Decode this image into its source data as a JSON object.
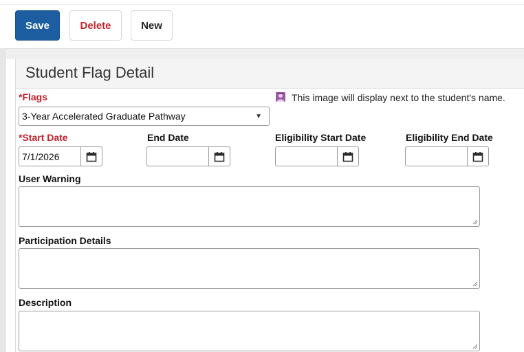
{
  "toolbar": {
    "save_label": "Save",
    "delete_label": "Delete",
    "new_label": "New"
  },
  "panel": {
    "title": "Student Flag Detail"
  },
  "form": {
    "flags": {
      "required_mark": "*",
      "label": "Flags",
      "selected": "3-Year Accelerated Graduate Pathway",
      "dropdown_icon": "triangle-down-icon"
    },
    "image_note": {
      "icon": "student-image-icon",
      "text": "This image will display next to the student's name."
    },
    "start_date": {
      "required_mark": "*",
      "label": "Start Date",
      "value": "7/1/2026",
      "icon": "calendar-icon"
    },
    "end_date": {
      "label": "End Date",
      "value": "",
      "icon": "calendar-icon"
    },
    "eligibility_start_date": {
      "label": "Eligibility Start Date",
      "value": "",
      "icon": "calendar-icon"
    },
    "eligibility_end_date": {
      "label": "Eligibility End Date",
      "value": "",
      "icon": "calendar-icon"
    },
    "user_warning": {
      "label": "User Warning",
      "value": ""
    },
    "participation_details": {
      "label": "Participation Details",
      "value": ""
    },
    "description": {
      "label": "Description",
      "value": ""
    }
  },
  "colors": {
    "primary_button": "#1d5ea0",
    "delete_text": "#c4262e",
    "required_label": "#c0202c",
    "image_icon": "#9b5aa5"
  }
}
